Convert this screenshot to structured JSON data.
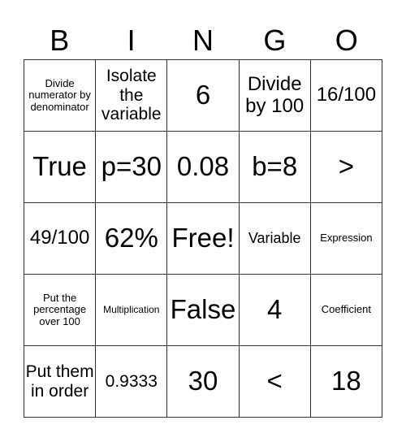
{
  "title_letters": [
    "B",
    "I",
    "N",
    "G",
    "O"
  ],
  "cells": [
    [
      "Divide numerator by denominator",
      "Isolate the variable",
      "6",
      "Divide by 100",
      "16/100"
    ],
    [
      "True",
      "p=30",
      "0.08",
      "b=8",
      ">"
    ],
    [
      "49/100",
      "62%",
      "Free!",
      "Variable",
      "Expression"
    ],
    [
      "Put the percentage over 100",
      "Multiplication",
      "False",
      "4",
      "Coefficient"
    ],
    [
      "Put them in order",
      "0.9333",
      "30",
      "<",
      "18"
    ]
  ]
}
